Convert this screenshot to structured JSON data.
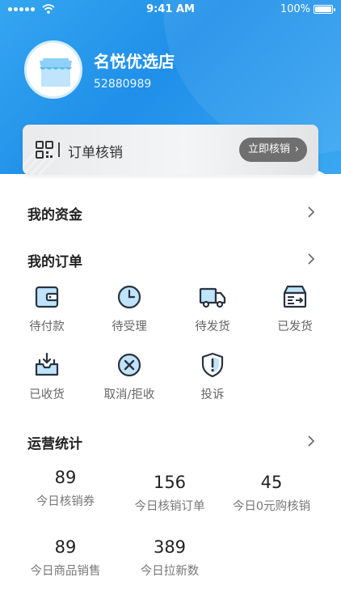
{
  "status_bar": {
    "time": "9:41 AM",
    "battery": "100%"
  },
  "store": {
    "name": "名悦优选店",
    "id": "52880989"
  },
  "verify": {
    "title": "订单核销",
    "button": "立即核销"
  },
  "funds": {
    "title": "我的资金"
  },
  "orders": {
    "title": "我的订单",
    "items": [
      {
        "label": "待付款",
        "icon": "wallet-icon"
      },
      {
        "label": "待受理",
        "icon": "clock-icon"
      },
      {
        "label": "待发货",
        "icon": "truck-icon"
      },
      {
        "label": "已发货",
        "icon": "shipped-box-icon"
      },
      {
        "label": "已收货",
        "icon": "received-box-icon"
      },
      {
        "label": "取消/拒收",
        "icon": "cancel-icon"
      },
      {
        "label": "投诉",
        "icon": "complaint-shield-icon"
      }
    ]
  },
  "stats": {
    "title": "运营统计",
    "items": [
      {
        "value": "89",
        "label": "今日核销券"
      },
      {
        "value": "156",
        "label": "今日核销订单"
      },
      {
        "value": "45",
        "label": "今日0元购核销"
      },
      {
        "value": "89",
        "label": "今日商品销售"
      },
      {
        "value": "389",
        "label": "今日拉新数"
      }
    ]
  },
  "colors": {
    "primary": "#2a9bef",
    "icon_fill": "#bfe4fb",
    "icon_stroke": "#2a3340"
  }
}
